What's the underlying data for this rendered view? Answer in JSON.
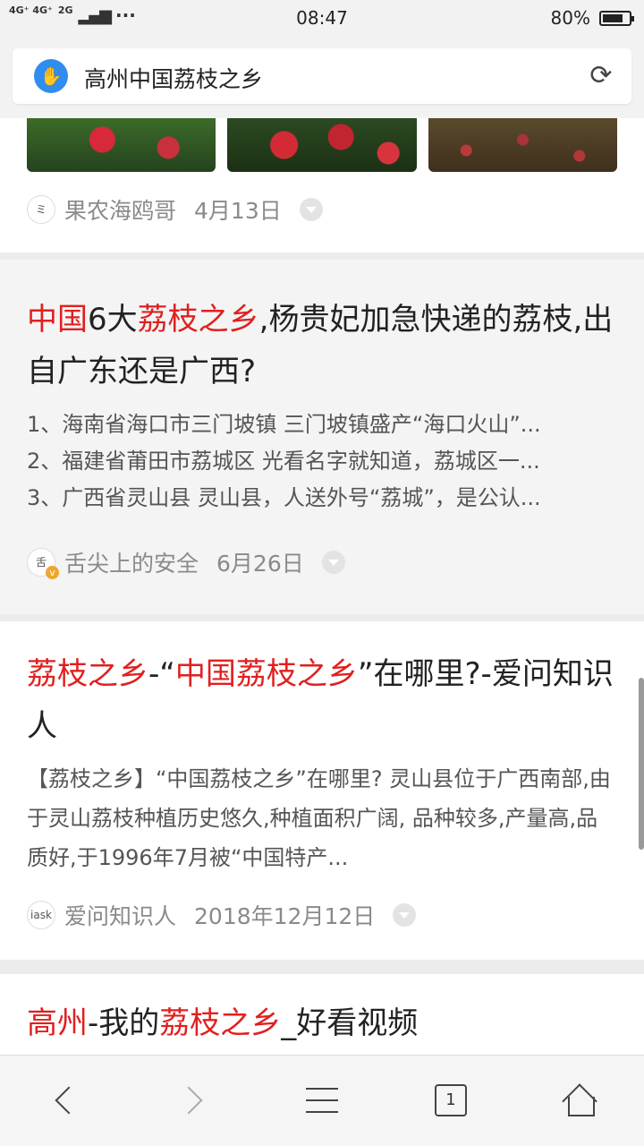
{
  "status_bar": {
    "network_1": "4G⁺ 4G⁺",
    "network_2": "2G",
    "time": "08:47",
    "battery_percent": "80%",
    "battery_level": 0.8
  },
  "address_bar": {
    "query": "高州中国荔枝之乡"
  },
  "results": [
    {
      "author": "果农海鸥哥",
      "date": "4月13日"
    },
    {
      "title_parts": [
        "中国",
        "6大",
        "荔枝之乡",
        ",杨贵妃加急快递的荔枝,出自广东还是广西?"
      ],
      "snippets": [
        "1、海南省海口市三门坡镇 三门坡镇盛产“海口火山”...",
        "2、福建省莆田市荔城区 光看名字就知道，荔城区一...",
        "3、广西省灵山县 灵山县，人送外号“荔城”，是公认..."
      ],
      "author": "舌尖上的安全",
      "date": "6月26日"
    },
    {
      "title_parts": [
        "荔枝之乡",
        "-“",
        "中国荔枝之乡",
        "”在哪里?-爱问知识人"
      ],
      "snippet": "【荔枝之乡】“中国荔枝之乡”在哪里? 灵山县位于广西南部,由于灵山荔枝种植历史悠久,种植面积广阔, 品种较多,产量高,品质好,于1996年7月被“中国特产...",
      "author": "爱问知识人",
      "date": "2018年12月12日"
    },
    {
      "title_parts": [
        "高州",
        "-我的",
        "荔枝之乡",
        "_好看视频"
      ]
    }
  ],
  "bottom_nav": {
    "tab_count": "1"
  },
  "colors": {
    "highlight": "#e02020",
    "baidu_blue": "#2f8df0"
  }
}
